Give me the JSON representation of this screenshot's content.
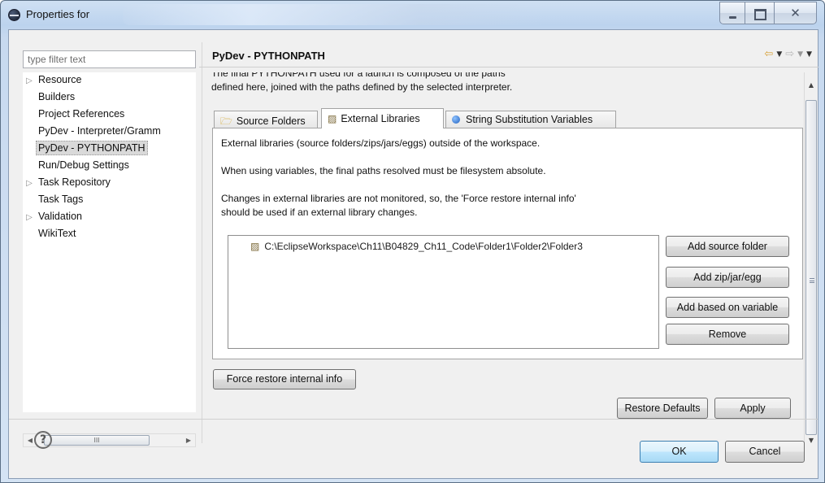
{
  "window": {
    "title": "Properties for"
  },
  "sidebar": {
    "filter_placeholder": "type filter text",
    "items": [
      {
        "label": "Resource",
        "expandable": true
      },
      {
        "label": "Builders",
        "expandable": false
      },
      {
        "label": "Project References",
        "expandable": false
      },
      {
        "label": "PyDev - Interpreter/Gramm",
        "expandable": false
      },
      {
        "label": "PyDev - PYTHONPATH",
        "expandable": false,
        "selected": true
      },
      {
        "label": "Run/Debug Settings",
        "expandable": false
      },
      {
        "label": "Task Repository",
        "expandable": true
      },
      {
        "label": "Task Tags",
        "expandable": false
      },
      {
        "label": "Validation",
        "expandable": true
      },
      {
        "label": "WikiText",
        "expandable": false
      }
    ],
    "scroll_thumb_glyph": "III"
  },
  "page": {
    "title": "PyDev - PYTHONPATH",
    "description_line1": "The final PYTHONPATH used for a launch is composed of the paths",
    "description_line2": "defined here, joined with the paths defined by the selected interpreter.",
    "tabs": [
      {
        "label": "Source Folders",
        "icon": "folder-icon"
      },
      {
        "label": "External Libraries",
        "icon": "library-icon",
        "active": true
      },
      {
        "label": "String Substitution Variables",
        "icon": "variable-icon"
      }
    ],
    "external": {
      "line1": "External libraries (source folders/zips/jars/eggs) outside of the workspace.",
      "line2": "When using variables, the final paths resolved must be filesystem absolute.",
      "line3": "Changes in external libraries are not monitored, so, the 'Force restore internal info'",
      "line4": "should be used if an external library changes.",
      "libraries": [
        "C:\\EclipseWorkspace\\Ch11\\B04829_Ch11_Code\\Folder1\\Folder2\\Folder3"
      ],
      "buttons": {
        "add_source_folder": "Add source folder",
        "add_zip": "Add zip/jar/egg",
        "add_variable": "Add based on variable",
        "remove": "Remove"
      }
    },
    "force_restore_label": "Force restore internal info",
    "restore_defaults_label": "Restore Defaults",
    "apply_label": "Apply"
  },
  "footer": {
    "help_glyph": "?",
    "ok_label": "OK",
    "cancel_label": "Cancel"
  },
  "colors": {
    "titlebar": "#bcd3ee",
    "ok_button": "#bee6fd",
    "back_arrow": "#d7a23b"
  }
}
